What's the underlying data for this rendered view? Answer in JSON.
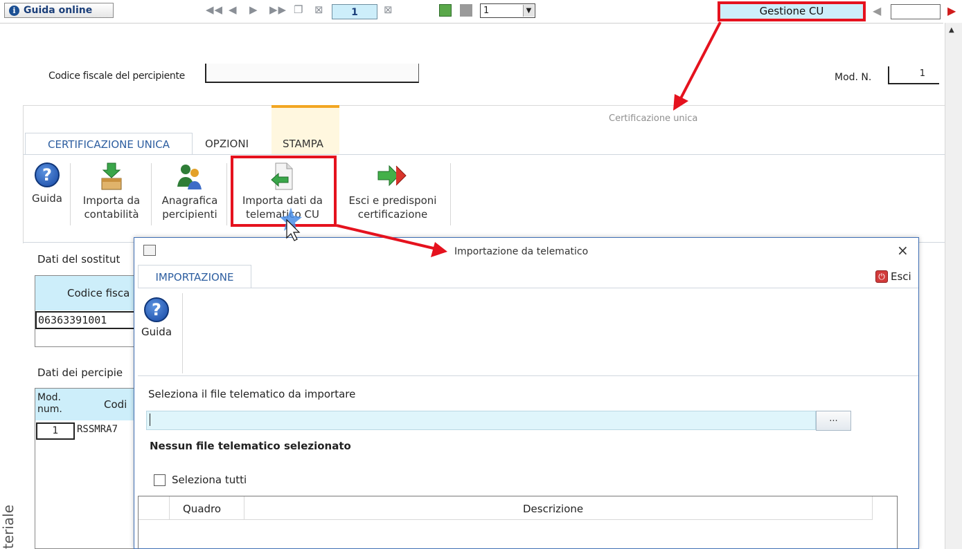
{
  "toolbar": {
    "guida_label": "Guida online",
    "page_value": "1",
    "select_value": "1",
    "gestione_label": "Gestione CU"
  },
  "form": {
    "cf_label": "Codice fiscale del percipiente",
    "mod_label": "Mod. N.",
    "mod_value": "1"
  },
  "ribbon": {
    "title": "Certificazione unica",
    "tabs": [
      "CERTIFICAZIONE UNICA",
      "OPZIONI",
      "STAMPA"
    ],
    "buttons": {
      "guida": "Guida",
      "importa_contab_1": "Importa da",
      "importa_contab_2": "contabilità",
      "anagrafica_1": "Anagrafica",
      "anagrafica_2": "percipienti",
      "importa_tel_1": "Importa dati da",
      "importa_tel_2": "telematico CU",
      "esci_1": "Esci e predisponi",
      "esci_2": "certificazione"
    }
  },
  "sostituto": {
    "label": "Dati del sostitut",
    "col_header": "Codice fisca",
    "cf_value": "06363391001"
  },
  "percipienti": {
    "label": "Dati dei percipie",
    "col_mod": "Mod. num.",
    "col_mod_1": "Mod.",
    "col_mod_2": "num.",
    "col_cod": "Codi",
    "row_mod": "1",
    "row_cf": "RSSMRA7"
  },
  "side_text": "teriale",
  "dialog": {
    "title": "Importazione da telematico",
    "close": "×",
    "tab": "IMPORTAZIONE",
    "esci": "Esci",
    "guida": "Guida",
    "select_label": "Seleziona il file telematico da importare",
    "file_value": "",
    "browse_label": "...",
    "status": "Nessun file telematico selezionato",
    "select_all": "Seleziona tutti",
    "col_quadro": "Quadro",
    "col_descrizione": "Descrizione"
  },
  "colors": {
    "highlight": "#e5121e",
    "field_bg": "#cdeefa",
    "accent": "#2d5ea0",
    "stampa_tab": "#f2a622"
  },
  "icons": [
    "info-icon",
    "first-page-icon",
    "prev-page-icon",
    "next-page-icon",
    "last-page-icon",
    "new-page-icon",
    "delete-page-icon",
    "help-icon",
    "import-box-icon",
    "people-icon",
    "import-file-icon",
    "exit-arrow-icon",
    "close-icon",
    "exit-icon",
    "checkbox-icon"
  ]
}
